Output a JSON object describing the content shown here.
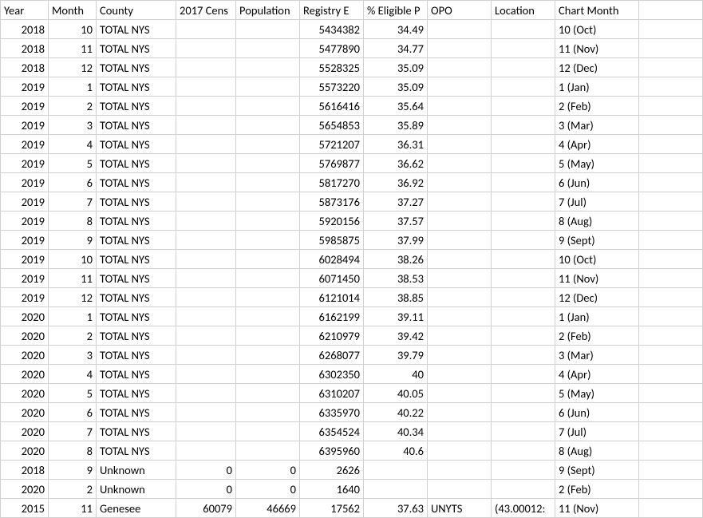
{
  "headers": {
    "year": "Year",
    "month": "Month",
    "county": "County",
    "cens": "2017 Cens",
    "pop": "Population",
    "reg": "Registry E",
    "elig": "% Eligible P",
    "opo": "OPO",
    "loc": "Location",
    "chart": "Chart Month"
  },
  "rows": [
    {
      "year": "2018",
      "month": "10",
      "county": "TOTAL NYS",
      "cens": "",
      "pop": "",
      "reg": "5434382",
      "elig": "34.49",
      "opo": "",
      "loc": "",
      "chart": "10 (Oct)"
    },
    {
      "year": "2018",
      "month": "11",
      "county": "TOTAL NYS",
      "cens": "",
      "pop": "",
      "reg": "5477890",
      "elig": "34.77",
      "opo": "",
      "loc": "",
      "chart": "11 (Nov)"
    },
    {
      "year": "2018",
      "month": "12",
      "county": "TOTAL NYS",
      "cens": "",
      "pop": "",
      "reg": "5528325",
      "elig": "35.09",
      "opo": "",
      "loc": "",
      "chart": "12 (Dec)"
    },
    {
      "year": "2019",
      "month": "1",
      "county": "TOTAL NYS",
      "cens": "",
      "pop": "",
      "reg": "5573220",
      "elig": "35.09",
      "opo": "",
      "loc": "",
      "chart": "1 (Jan)"
    },
    {
      "year": "2019",
      "month": "2",
      "county": "TOTAL NYS",
      "cens": "",
      "pop": "",
      "reg": "5616416",
      "elig": "35.64",
      "opo": "",
      "loc": "",
      "chart": "2 (Feb)"
    },
    {
      "year": "2019",
      "month": "3",
      "county": "TOTAL NYS",
      "cens": "",
      "pop": "",
      "reg": "5654853",
      "elig": "35.89",
      "opo": "",
      "loc": "",
      "chart": "3 (Mar)"
    },
    {
      "year": "2019",
      "month": "4",
      "county": "TOTAL NYS",
      "cens": "",
      "pop": "",
      "reg": "5721207",
      "elig": "36.31",
      "opo": "",
      "loc": "",
      "chart": "4 (Apr)"
    },
    {
      "year": "2019",
      "month": "5",
      "county": "TOTAL NYS",
      "cens": "",
      "pop": "",
      "reg": "5769877",
      "elig": "36.62",
      "opo": "",
      "loc": "",
      "chart": "5 (May)"
    },
    {
      "year": "2019",
      "month": "6",
      "county": "TOTAL NYS",
      "cens": "",
      "pop": "",
      "reg": "5817270",
      "elig": "36.92",
      "opo": "",
      "loc": "",
      "chart": "6 (Jun)"
    },
    {
      "year": "2019",
      "month": "7",
      "county": "TOTAL NYS",
      "cens": "",
      "pop": "",
      "reg": "5873176",
      "elig": "37.27",
      "opo": "",
      "loc": "",
      "chart": "7 (Jul)"
    },
    {
      "year": "2019",
      "month": "8",
      "county": "TOTAL NYS",
      "cens": "",
      "pop": "",
      "reg": "5920156",
      "elig": "37.57",
      "opo": "",
      "loc": "",
      "chart": "8 (Aug)"
    },
    {
      "year": "2019",
      "month": "9",
      "county": "TOTAL NYS",
      "cens": "",
      "pop": "",
      "reg": "5985875",
      "elig": "37.99",
      "opo": "",
      "loc": "",
      "chart": "9 (Sept)"
    },
    {
      "year": "2019",
      "month": "10",
      "county": "TOTAL NYS",
      "cens": "",
      "pop": "",
      "reg": "6028494",
      "elig": "38.26",
      "opo": "",
      "loc": "",
      "chart": "10 (Oct)"
    },
    {
      "year": "2019",
      "month": "11",
      "county": "TOTAL NYS",
      "cens": "",
      "pop": "",
      "reg": "6071450",
      "elig": "38.53",
      "opo": "",
      "loc": "",
      "chart": "11 (Nov)"
    },
    {
      "year": "2019",
      "month": "12",
      "county": "TOTAL NYS",
      "cens": "",
      "pop": "",
      "reg": "6121014",
      "elig": "38.85",
      "opo": "",
      "loc": "",
      "chart": "12 (Dec)"
    },
    {
      "year": "2020",
      "month": "1",
      "county": "TOTAL NYS",
      "cens": "",
      "pop": "",
      "reg": "6162199",
      "elig": "39.11",
      "opo": "",
      "loc": "",
      "chart": "1 (Jan)"
    },
    {
      "year": "2020",
      "month": "2",
      "county": "TOTAL NYS",
      "cens": "",
      "pop": "",
      "reg": "6210979",
      "elig": "39.42",
      "opo": "",
      "loc": "",
      "chart": "2 (Feb)"
    },
    {
      "year": "2020",
      "month": "3",
      "county": "TOTAL NYS",
      "cens": "",
      "pop": "",
      "reg": "6268077",
      "elig": "39.79",
      "opo": "",
      "loc": "",
      "chart": "3 (Mar)"
    },
    {
      "year": "2020",
      "month": "4",
      "county": "TOTAL NYS",
      "cens": "",
      "pop": "",
      "reg": "6302350",
      "elig": "40",
      "opo": "",
      "loc": "",
      "chart": "4 (Apr)"
    },
    {
      "year": "2020",
      "month": "5",
      "county": "TOTAL NYS",
      "cens": "",
      "pop": "",
      "reg": "6310207",
      "elig": "40.05",
      "opo": "",
      "loc": "",
      "chart": "5 (May)"
    },
    {
      "year": "2020",
      "month": "6",
      "county": "TOTAL NYS",
      "cens": "",
      "pop": "",
      "reg": "6335970",
      "elig": "40.22",
      "opo": "",
      "loc": "",
      "chart": "6 (Jun)"
    },
    {
      "year": "2020",
      "month": "7",
      "county": "TOTAL NYS",
      "cens": "",
      "pop": "",
      "reg": "6354524",
      "elig": "40.34",
      "opo": "",
      "loc": "",
      "chart": "7 (Jul)"
    },
    {
      "year": "2020",
      "month": "8",
      "county": "TOTAL NYS",
      "cens": "",
      "pop": "",
      "reg": "6395960",
      "elig": "40.6",
      "opo": "",
      "loc": "",
      "chart": "8 (Aug)"
    },
    {
      "year": "2018",
      "month": "9",
      "county": "Unknown",
      "cens": "0",
      "pop": "0",
      "reg": "2626",
      "elig": "",
      "opo": "",
      "loc": "",
      "chart": "9 (Sept)"
    },
    {
      "year": "2020",
      "month": "2",
      "county": "Unknown",
      "cens": "0",
      "pop": "0",
      "reg": "1640",
      "elig": "",
      "opo": "",
      "loc": "",
      "chart": "2 (Feb)"
    },
    {
      "year": "2015",
      "month": "11",
      "county": "Genesee",
      "cens": "60079",
      "pop": "46669",
      "reg": "17562",
      "elig": "37.63",
      "opo": "UNYTS",
      "loc": "(43.00012:",
      "chart": "11 (Nov)"
    }
  ]
}
